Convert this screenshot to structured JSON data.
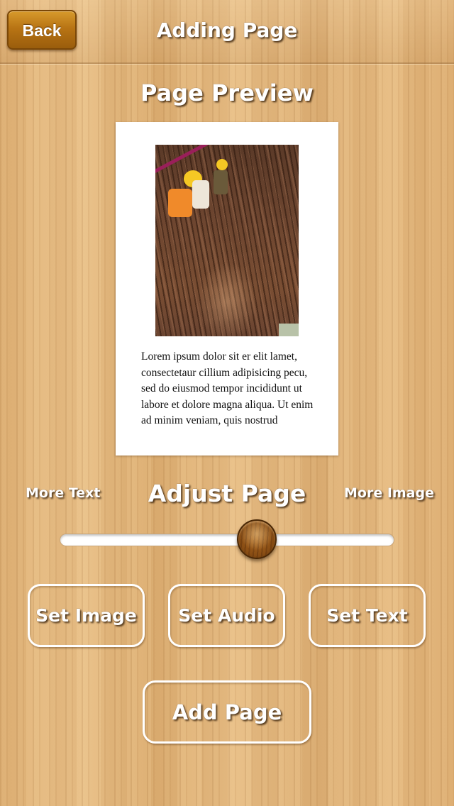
{
  "navbar": {
    "back_label": "Back",
    "title": "Adding Page"
  },
  "preview": {
    "section_title": "Page Preview",
    "body_text": "Lorem ipsum dolor sit er elit lamet, consectetaur cillium adipisicing pecu, sed do eiusmod tempor incididunt ut labore et dolore magna aliqua. Ut enim ad minim veniam, quis nostrud"
  },
  "adjust": {
    "title": "Adjust Page",
    "left_label": "More Text",
    "right_label": "More Image",
    "slider_value_percent": 60
  },
  "actions": {
    "set_image_label": "Set Image",
    "set_audio_label": "Set Audio",
    "set_text_label": "Set Text",
    "add_page_label": "Add Page"
  },
  "colors": {
    "wood": "#e1b47a",
    "back_button": "#b87414",
    "knob": "#8a4e14",
    "button_outline": "#ffffff"
  }
}
